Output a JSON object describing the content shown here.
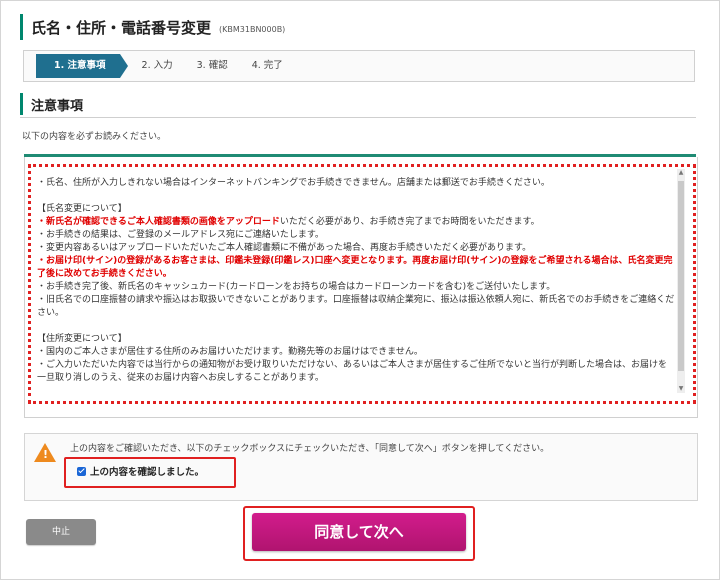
{
  "header": {
    "title": "氏名・住所・電話番号変更",
    "code": "(KBM31BN000B)"
  },
  "steps": [
    {
      "label": "1. 注意事項",
      "active": true
    },
    {
      "label": "2. 入力",
      "active": false
    },
    {
      "label": "3. 確認",
      "active": false
    },
    {
      "label": "4. 完了",
      "active": false
    }
  ],
  "section": {
    "title": "注意事項",
    "intro": "以下の内容を必ずお読みください。"
  },
  "notice": {
    "line1": "・氏名、住所が入力しきれない場合はインターネットバンキングでお手続きできません。店舗または郵送でお手続きください。",
    "name_heading": "【氏名変更について】",
    "name_1_red": "・新氏名が確認できるご本人確認書類の画像をアップロード",
    "name_1_rest": "いただく必要があり、お手続き完了までお時間をいただきます。",
    "name_2": "・お手続きの結果は、ご登録のメールアドレス宛にご連絡いたします。",
    "name_3": "・変更内容あるいはアップロードいただいたご本人確認書類に不備があった場合、再度お手続きいただく必要があります。",
    "name_4_red": "・お届け印(サイン)の登録があるお客さまは、印鑑未登録(印鑑レス)口座へ変更となります。再度お届け印(サイン)の登録をご希望される場合は、氏名変更完了後に改めてお手続きください。",
    "name_5": "・お手続き完了後、新氏名のキャッシュカード(カードローンをお持ちの場合はカードローンカードを含む)をご送付いたします。",
    "name_6": "・旧氏名での口座振替の請求や振込はお取扱いできないことがあります。口座振替は収納企業宛に、振込は振込依頼人宛に、新氏名でのお手続きをご連絡ください。",
    "address_heading": "【住所変更について】",
    "address_1": "・国内のご本人さまが居住する住所のみお届けいただけます。勤務先等のお届けはできません。",
    "address_2": "・ご入力いただいた内容では当行からの通知物がお受け取りいただけない、あるいはご本人さまが居住するご住所でないと当行が判断した場合は、お届けを一旦取り消しのうえ、従来のお届け内容へお戻しすることがあります。"
  },
  "confirm": {
    "message": "上の内容をご確認いただき、以下のチェックボックスにチェックいただき、「同意して次へ」ボタンを押してください。",
    "checkbox_label": "上の内容を確認しました。",
    "checked": true
  },
  "buttons": {
    "cancel": "中止",
    "agree": "同意して次へ"
  },
  "colors": {
    "accent_green": "#00876e",
    "step_active": "#1f6f8f",
    "agree_button": "#c0187f",
    "warning": "#ee8a1e",
    "highlight_red": "#e02020"
  }
}
